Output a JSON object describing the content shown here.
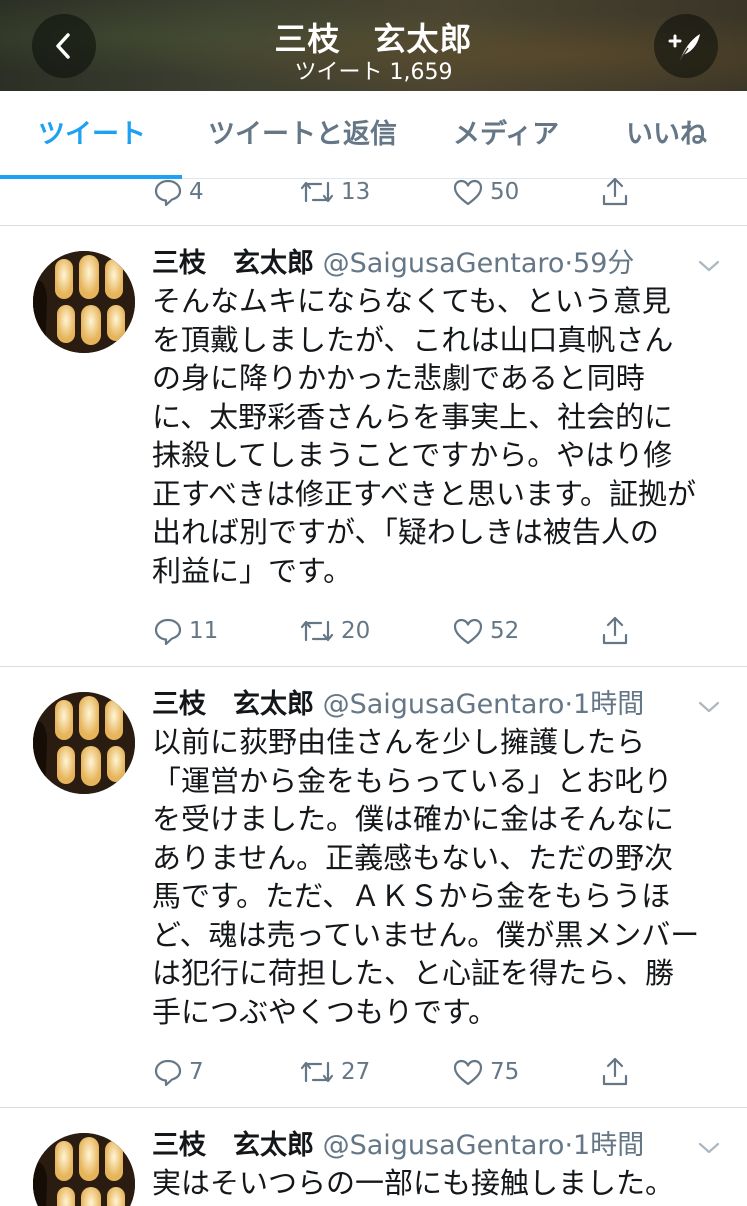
{
  "header": {
    "title": "三枝　玄太郎",
    "tweet_count_label": "ツイート 1,659"
  },
  "tabs": [
    {
      "label": "ツイート",
      "active": true
    },
    {
      "label": "ツイートと返信",
      "active": false
    },
    {
      "label": "メディア",
      "active": false
    },
    {
      "label": "いいね",
      "active": false
    }
  ],
  "partial_tweet": {
    "replies": "4",
    "retweets": "13",
    "likes": "50"
  },
  "tweets": [
    {
      "name": "三枝　玄太郎",
      "handle": "@SaigusaGentaro",
      "dot": "·",
      "time": "59分",
      "text": "そんなムキにならなくても、という意見\nを頂戴しましたが、これは山口真帆さん\nの身に降りかかった悲劇であると同時\nに、太野彩香さんらを事実上、社会的に\n抹殺してしまうことですから。やはり修\n正すべきは修正すべきと思います。証拠が\n出れば別ですが、「疑わしきは被告人の\n利益に」です。",
      "replies": "11",
      "retweets": "20",
      "likes": "52"
    },
    {
      "name": "三枝　玄太郎",
      "handle": "@SaigusaGentaro",
      "dot": "·",
      "time": "1時間",
      "text": "以前に荻野由佳さんを少し擁護したら\n「運営から金をもらっている」とお叱り\nを受けました。僕は確かに金はそんなに\nありません。正義感もない、ただの野次\n馬です。ただ、ＡＫＳから金をもらうほ\nど、魂は売っていません。僕が黒メンバー\nは犯行に荷担した、と心証を得たら、勝\n手につぶやくつもりです。",
      "replies": "7",
      "retweets": "27",
      "likes": "75"
    },
    {
      "name": "三枝　玄太郎",
      "handle": "@SaigusaGentaro",
      "dot": "·",
      "time": "1時間",
      "text": "実はそいつらの一部にも接触しました。"
    }
  ],
  "colors": {
    "accent": "#1da1f2",
    "muted": "#657786",
    "text": "#14171a"
  }
}
